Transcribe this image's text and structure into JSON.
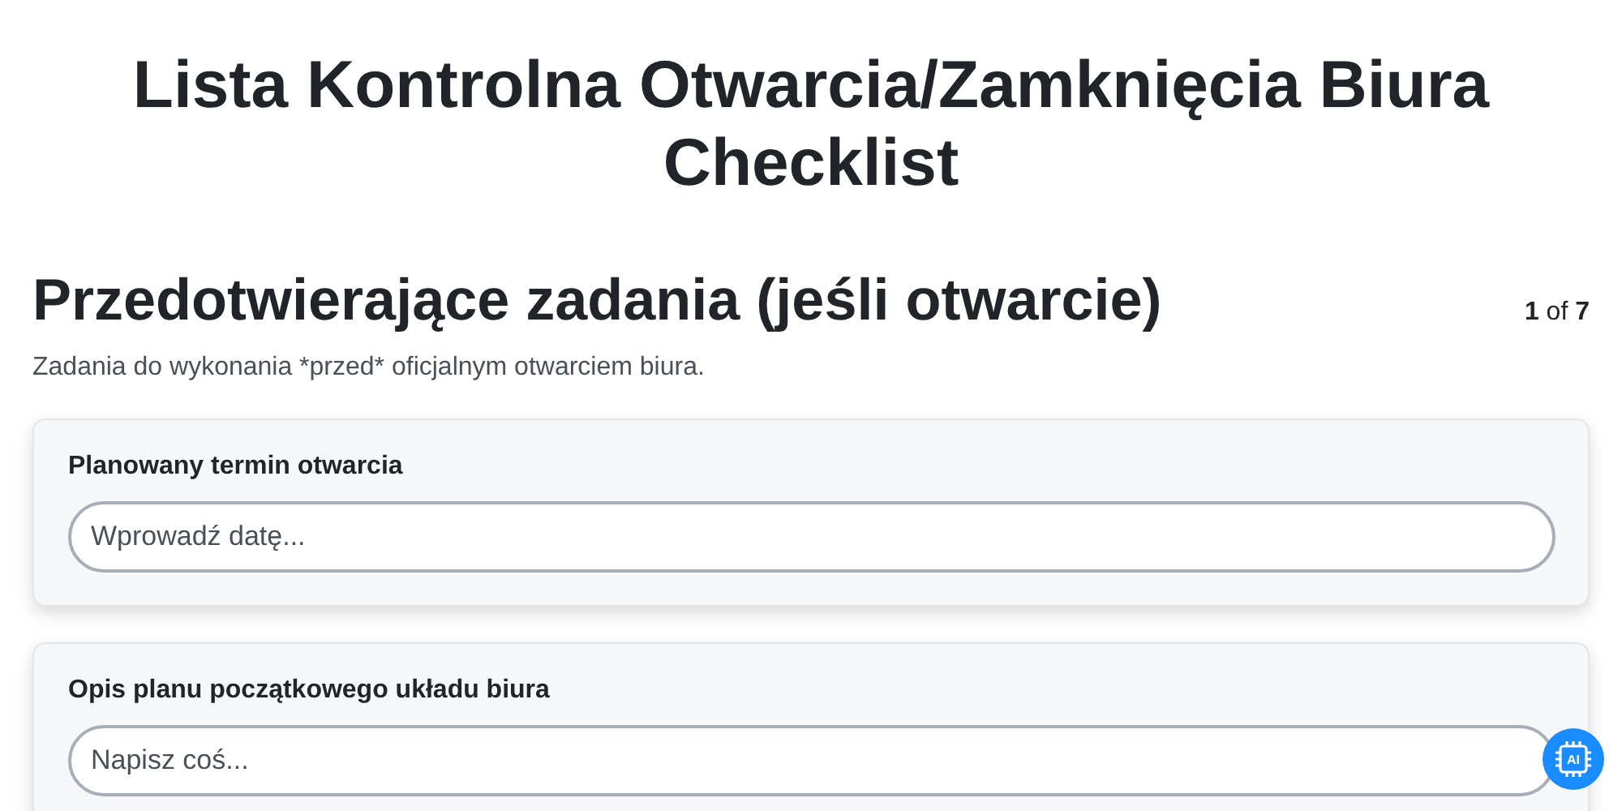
{
  "title": "Lista Kontrolna Otwarcia/Zamknięcia Biura Checklist",
  "section": {
    "heading": "Przedotwierające zadania (jeśli otwarcie)",
    "progress": "**1** of **7**",
    "description": "Zadania do wykonania *przed* oficjalnym otwarciem biura."
  },
  "fields": [
    {
      "label": "Planowany termin otwarcia",
      "placeholder": "Wprowadź datę..."
    },
    {
      "label": "Opis planu początkowego układu biura",
      "placeholder": "Napisz coś..."
    }
  ],
  "ai_button": {
    "label": "AI"
  }
}
